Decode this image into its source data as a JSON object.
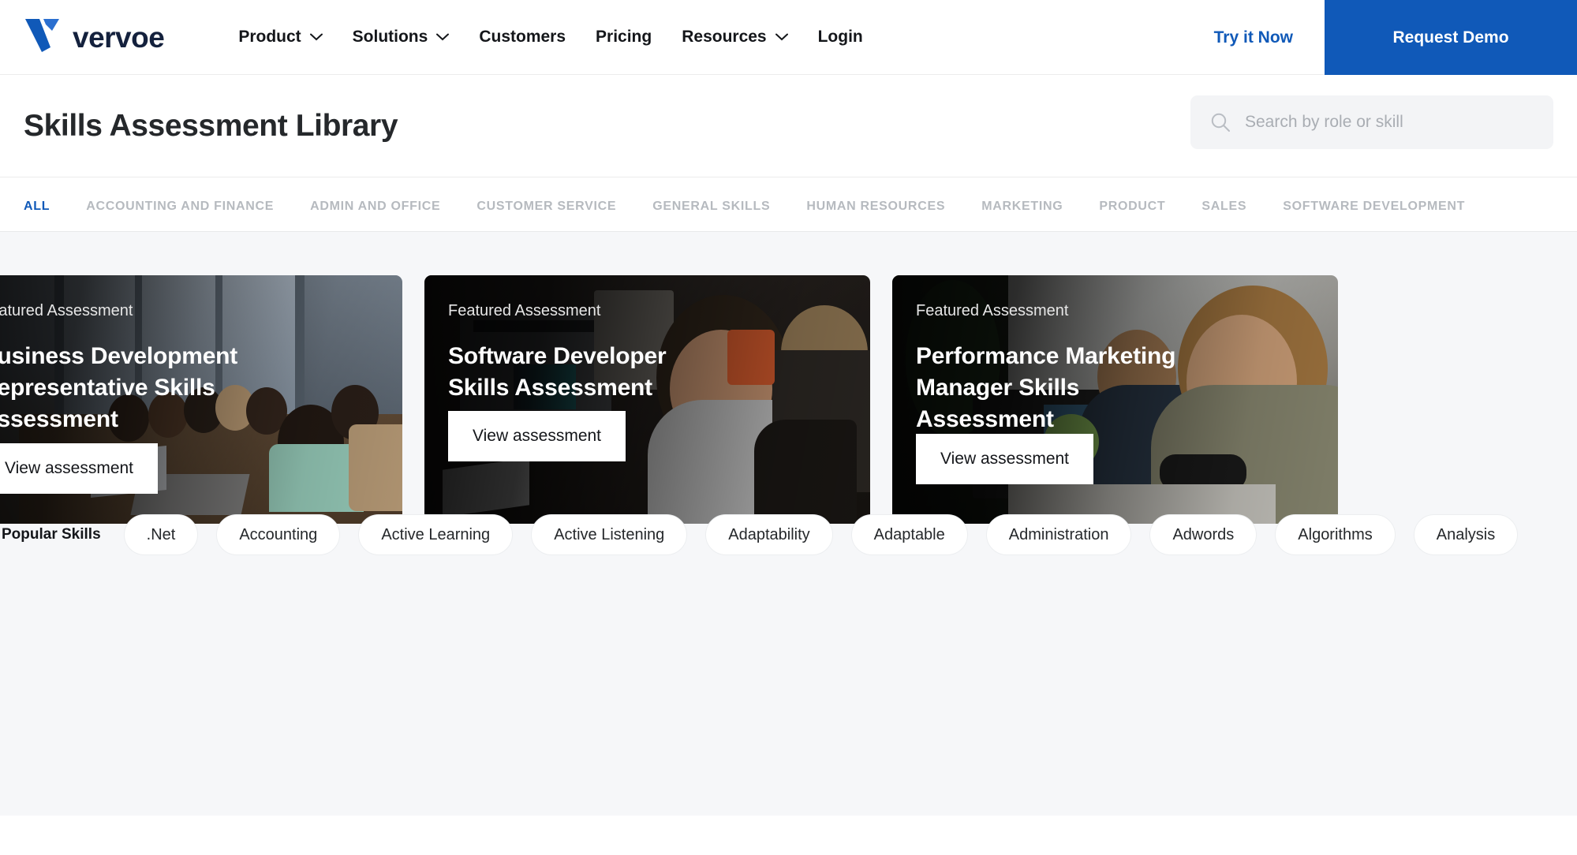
{
  "brand": {
    "name": "vervoe",
    "logo_icon": "vervoe-v-mark",
    "primary_color": "#1059b8",
    "wordmark_color": "#14213d"
  },
  "nav": {
    "items": [
      {
        "label": "Product",
        "has_dropdown": true,
        "icon": "chevron-down-icon"
      },
      {
        "label": "Solutions",
        "has_dropdown": true,
        "icon": "chevron-down-icon"
      },
      {
        "label": "Customers",
        "has_dropdown": false
      },
      {
        "label": "Pricing",
        "has_dropdown": false
      },
      {
        "label": "Resources",
        "has_dropdown": true,
        "icon": "chevron-down-icon"
      },
      {
        "label": "Login",
        "has_dropdown": false
      }
    ],
    "try_it_now_label": "Try it Now",
    "request_demo_label": "Request Demo"
  },
  "header": {
    "title": "Skills Assessment Library"
  },
  "search": {
    "placeholder": "Search by role or skill",
    "value": "",
    "icon": "search-icon"
  },
  "tabs": {
    "active": "ALL",
    "items": [
      "ALL",
      "ACCOUNTING AND FINANCE",
      "ADMIN AND OFFICE",
      "CUSTOMER SERVICE",
      "GENERAL SKILLS",
      "HUMAN RESOURCES",
      "MARKETING",
      "PRODUCT",
      "SALES",
      "SOFTWARE DEVELOPMENT"
    ]
  },
  "featured": {
    "cards": [
      {
        "eyebrow": "Featured Assessment",
        "title": "Business Development Representative Skills Assessment",
        "cta": "View assessment",
        "image_alt": "people seated around a conference table with laptops in a glass-walled meeting room"
      },
      {
        "eyebrow": "Featured Assessment",
        "title": "Software Developer Skills Assessment",
        "cta": "View assessment",
        "image_alt": "developer in a grey sweater working at a desktop monitor in a dim office"
      },
      {
        "eyebrow": "Featured Assessment",
        "title": "Performance Marketing Manager Skills Assessment",
        "cta": "View assessment",
        "image_alt": "two men working at desktop computers in a bright office"
      }
    ]
  },
  "popular_skills": {
    "label": "Popular Skills",
    "pills": [
      ".Net",
      "Accounting",
      "Active Learning",
      "Active Listening",
      "Adaptability",
      "Adaptable",
      "Administration",
      "Adwords",
      "Algorithms",
      "Analysis"
    ]
  }
}
